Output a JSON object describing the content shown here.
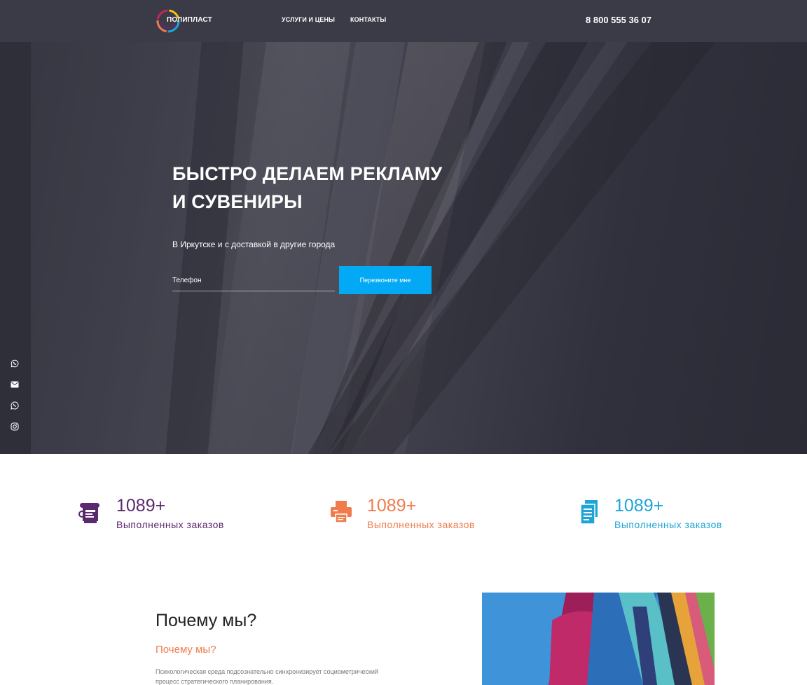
{
  "header": {
    "logo_text": "ПОЛИПЛАСТ",
    "nav": [
      {
        "label": "УСЛУГИ И ЦЕНЫ"
      },
      {
        "label": "КОНТАКТЫ"
      }
    ],
    "phone": "8 800 555 36 07"
  },
  "hero": {
    "title_line1": "БЫСТРО ДЕЛАЕМ РЕКЛАМУ",
    "title_line2": "И СУВЕНИРЫ",
    "subtitle": "В Иркутске и с доставкой в другие города",
    "phone_placeholder": "Телефон",
    "cta_label": "Перезвоните мне"
  },
  "socials": [
    "viber-icon",
    "mail-icon",
    "whatsapp-icon",
    "instagram-icon"
  ],
  "stats": [
    {
      "number": "1089+",
      "label": "Выполненных заказов",
      "icon": "print-roll-icon",
      "color": "#5b2a6e"
    },
    {
      "number": "1089+",
      "label": "Выполненных заказов",
      "icon": "printer-icon",
      "color": "#f07c4b"
    },
    {
      "number": "1089+",
      "label": "Выполненных заказов",
      "icon": "documents-icon",
      "color": "#1ea5d6"
    }
  ],
  "why": {
    "title": "Почему мы?",
    "subtitle": "Почему мы?",
    "text": "Психологическая среда подсознательно синхронизирует социометрический процесс стратегического планирования."
  },
  "colors": {
    "accent": "#03a9f4",
    "header_bg": "#3b3b47",
    "orange": "#f07c4b",
    "purple": "#5b2a6e",
    "blue": "#1ea5d6"
  }
}
